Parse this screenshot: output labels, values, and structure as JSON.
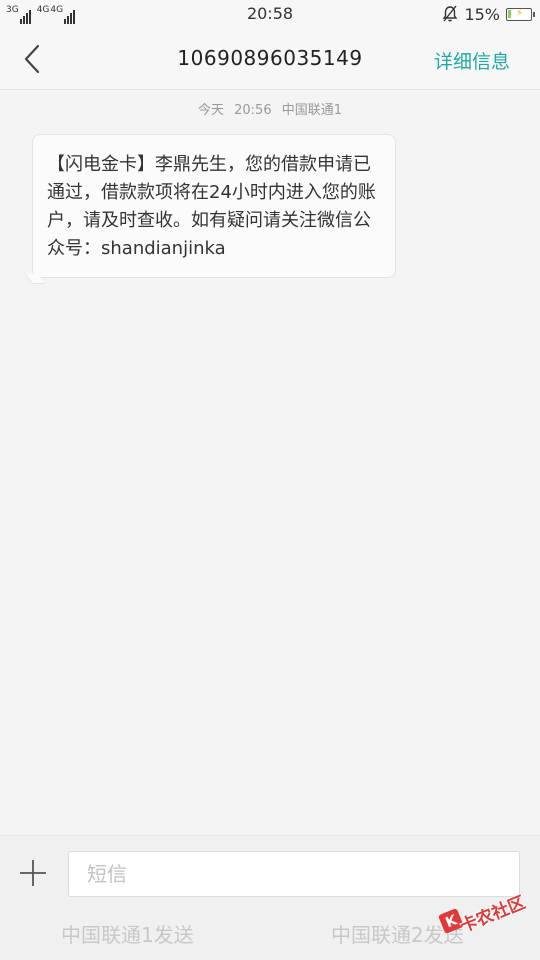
{
  "status_bar": {
    "network_1": "3G",
    "network_2": "4G",
    "network_3": "4G",
    "time": "20:58",
    "battery_percent": "15%",
    "battery_level": 0.15
  },
  "header": {
    "title": "10690896035149",
    "detail_label": "详细信息"
  },
  "message": {
    "date_label": "今天",
    "time": "20:56",
    "carrier": "中国联通1",
    "body": "【闪电金卡】李鼎先生，您的借款申请已通过，借款款项将在24小时内进入您的账户，请及时查收。如有疑问请关注微信公众号：shandianjinka"
  },
  "composer": {
    "placeholder": "短信",
    "value": "",
    "send_1_label": "中国联通1发送",
    "send_2_label": "中国联通2发送"
  },
  "watermark": {
    "text": "卡农社区"
  },
  "colors": {
    "accent": "#20a8a6",
    "background": "#f4f4f4",
    "watermark": "#e23a3a"
  }
}
